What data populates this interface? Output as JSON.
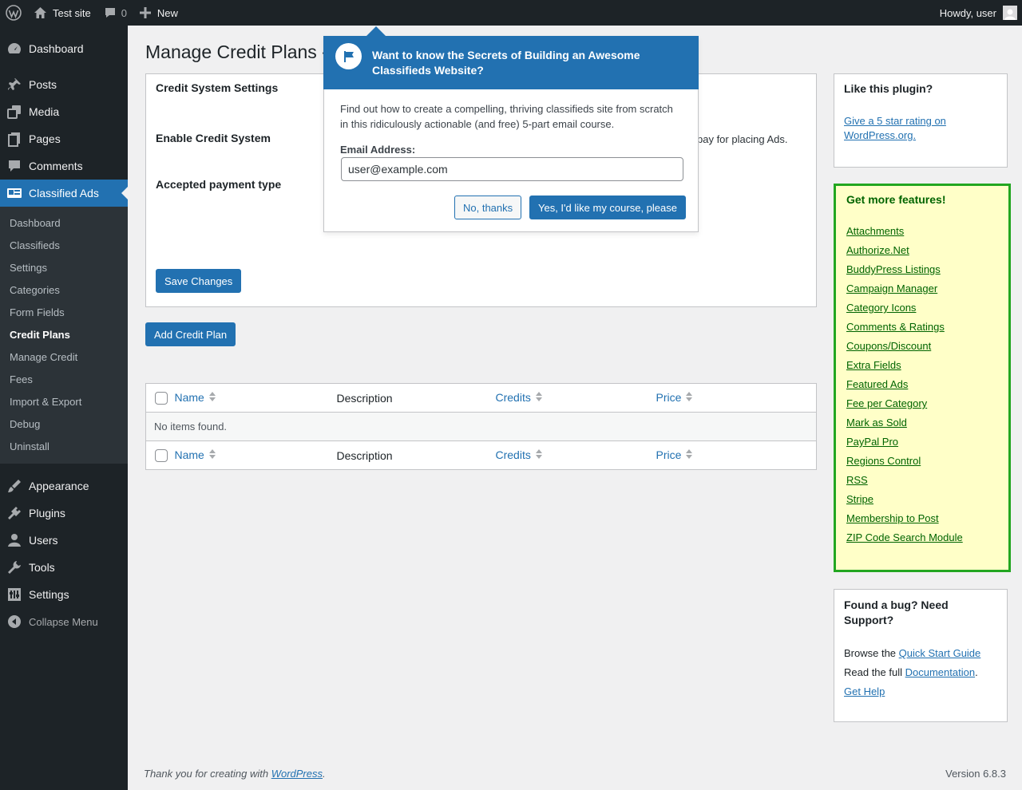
{
  "admin_bar": {
    "site_name": "Test site",
    "comments_count": "0",
    "new_label": "New",
    "greeting": "Howdy, user"
  },
  "sidebar": {
    "items_top": [
      {
        "label": "Dashboard",
        "icon": "dashboard-icon"
      },
      {
        "label": "Posts",
        "icon": "pushpin-icon"
      },
      {
        "label": "Media",
        "icon": "media-icon"
      },
      {
        "label": "Pages",
        "icon": "pages-icon"
      },
      {
        "label": "Comments",
        "icon": "comment-icon"
      },
      {
        "label": "Classified Ads",
        "icon": "classified-ads-icon"
      }
    ],
    "submenu": [
      "Dashboard",
      "Classifieds",
      "Settings",
      "Categories",
      "Form Fields",
      "Credit Plans",
      "Manage Credit",
      "Fees",
      "Import & Export",
      "Debug",
      "Uninstall"
    ],
    "items_bottom": [
      {
        "label": "Appearance",
        "icon": "brush-icon"
      },
      {
        "label": "Plugins",
        "icon": "plugin-icon"
      },
      {
        "label": "Users",
        "icon": "users-icon"
      },
      {
        "label": "Tools",
        "icon": "wrench-icon"
      },
      {
        "label": "Settings",
        "icon": "settings-icon"
      }
    ],
    "collapse_label": "Collapse Menu"
  },
  "main": {
    "title": "Manage Credit Plans -",
    "settings_section_title": "Credit System Settings",
    "enable_label": "Enable Credit System",
    "enable_desc_visible": "pay for placing Ads.",
    "payment_label": "Accepted payment type",
    "save_label": "Save Changes",
    "add_plan_label": "Add Credit Plan",
    "table": {
      "columns": [
        "Name",
        "Description",
        "Credits",
        "Price"
      ],
      "empty_text": "No items found."
    }
  },
  "popup": {
    "title": "Want to know the Secrets of Building an Awesome Classifieds Website?",
    "text": "Find out how to create a compelling, thriving classifieds site from scratch in this ridiculously actionable (and free) 5-part email course.",
    "email_label": "Email Address:",
    "email_value": "user@example.com",
    "no_label": "No, thanks",
    "yes_label": "Yes, I'd like my course, please"
  },
  "like_box": {
    "title": "Like this plugin?",
    "link": "Give a 5 star rating on WordPress.org."
  },
  "features_box": {
    "title": "Get more features!",
    "items": [
      "Attachments",
      "Authorize.Net",
      "BuddyPress Listings",
      "Campaign Manager",
      "Category Icons",
      "Comments & Ratings",
      "Coupons/Discount",
      "Extra Fields",
      "Featured Ads",
      "Fee per Category",
      "Mark as Sold",
      "PayPal Pro",
      "Regions Control",
      "RSS",
      "Stripe",
      "Membership to Post",
      "ZIP Code Search Module"
    ]
  },
  "support_box": {
    "title": "Found a bug? Need Support?",
    "browse_prefix": "Browse the",
    "quick_start": "Quick Start Guide",
    "read_prefix": "Read the full",
    "documentation": "Documentation",
    "period": ".",
    "get_help": "Get Help"
  },
  "footer": {
    "thanks_prefix": "Thank you for creating with",
    "wordpress_link": "WordPress",
    "period": ".",
    "version": "Version 6.8.3"
  },
  "colors": {
    "admin_dark": "#1d2327",
    "accent": "#2271b1",
    "features_bg": "#ffffc8",
    "features_border": "#22a620"
  }
}
